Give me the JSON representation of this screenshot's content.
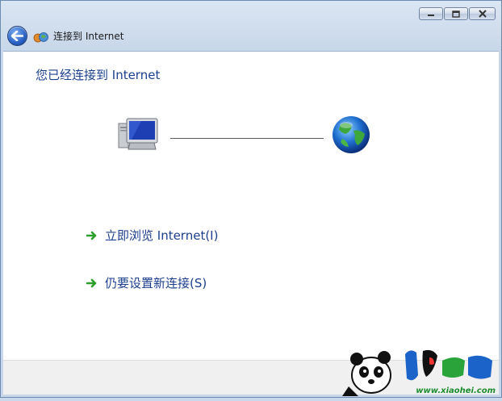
{
  "window": {
    "title": "连接到 Internet",
    "caption_buttons": [
      "minimize",
      "maximize",
      "close"
    ]
  },
  "content": {
    "heading": "您已经连接到 Internet",
    "connection": {
      "left_icon": "computer-icon",
      "right_icon": "globe-icon"
    },
    "tasks": [
      {
        "label": "立即浏览 Internet(I)",
        "icon": "green-arrow-icon"
      },
      {
        "label": "仍要设置新连接(S)",
        "icon": "green-arrow-icon"
      }
    ]
  },
  "watermark": {
    "url": "www.xiaohei.com"
  },
  "colors": {
    "link_blue": "#1c3f8f",
    "arrow_green": "#2ca02c",
    "frame_blue": "#c8d7e9"
  }
}
